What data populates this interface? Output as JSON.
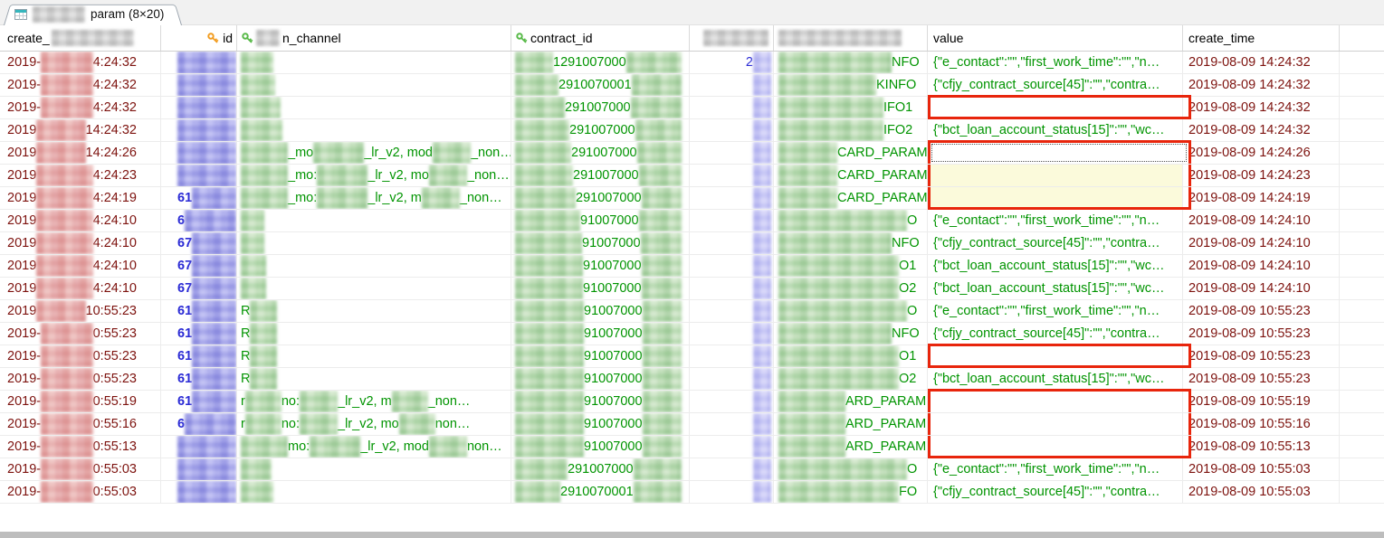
{
  "tab": {
    "label": "param (8×20)"
  },
  "header": {
    "c1": "create_",
    "c2": "id",
    "c3_suffix": "n_channel",
    "c4": "contract_id",
    "c7": "value",
    "c8": "create_time"
  },
  "colors": {
    "highlight_red": "#e8250c",
    "data_green": "#009400",
    "id_blue": "#2b2bd5",
    "datetime_maroon": "#7d120e",
    "selected_cell_yellow": "#fbfadb"
  },
  "rows": [
    {
      "tp": "2019-",
      "ts": "4:24:32",
      "id": "",
      "lead": "",
      "frags": [],
      "contract": "1291007000",
      "num": "2",
      "param": "NFO",
      "value": "{\"e_contact\":\"\",\"first_work_time\":\"\",\"n…",
      "ct": "2019-08-09 14:24:32",
      "vs": ""
    },
    {
      "tp": "2019-",
      "ts": "4:24:32",
      "id": "",
      "lead": "",
      "frags": [],
      "contract": "2910070001",
      "num": "",
      "param": "KINFO",
      "value": "{\"cfjy_contract_source[45]\":\"\",\"contra…",
      "ct": "2019-08-09 14:24:32",
      "vs": ""
    },
    {
      "tp": "2019-",
      "ts": "4:24:32",
      "id": "",
      "lead": "",
      "frags": [],
      "contract": "291007000",
      "num": "",
      "param": "IFO1",
      "value": "",
      "ct": "2019-08-09 14:24:32",
      "vs": "box"
    },
    {
      "tp": "2019",
      "ts": "14:24:32",
      "id": "",
      "lead": "",
      "frags": [],
      "contract": "291007000",
      "num": "",
      "param": "IFO2",
      "value": "{\"bct_loan_account_status[15]\":\"\",\"wc…",
      "ct": "2019-08-09 14:24:32",
      "vs": ""
    },
    {
      "tp": "2019",
      "ts": "14:24:26",
      "id": "",
      "lead": "",
      "frags": [
        "_mo",
        "_lr_v2, mod",
        "_non…"
      ],
      "contract": "291007000",
      "num": "",
      "param": "CARD_PARAM",
      "value": "",
      "ct": "2019-08-09 14:24:26",
      "vs": "boxtop focus"
    },
    {
      "tp": "2019",
      "ts": "4:24:23",
      "id": "",
      "lead": "",
      "frags": [
        "_mo:",
        "_lr_v2, mo",
        "_non…"
      ],
      "contract": "291007000",
      "num": "",
      "param": "CARD_PARAM",
      "value": "",
      "ct": "2019-08-09 14:24:23",
      "vs": "boxmid yellow"
    },
    {
      "tp": "2019",
      "ts": "4:24:19",
      "id": "61",
      "lead": "",
      "frags": [
        "_mo:",
        "_lr_v2, m",
        "_non…"
      ],
      "contract": "291007000",
      "num": "",
      "param": "CARD_PARAM",
      "value": "",
      "ct": "2019-08-09 14:24:19",
      "vs": "boxbot yellow"
    },
    {
      "tp": "2019",
      "ts": "4:24:10",
      "id": "6",
      "lead": "",
      "frags": [],
      "contract": "91007000",
      "num": "",
      "param": "O",
      "value": "{\"e_contact\":\"\",\"first_work_time\":\"\",\"n…",
      "ct": "2019-08-09 14:24:10",
      "vs": ""
    },
    {
      "tp": "2019",
      "ts": "4:24:10",
      "id": "67",
      "lead": "",
      "frags": [],
      "contract": "91007000",
      "num": "",
      "param": "NFO",
      "value": "{\"cfjy_contract_source[45]\":\"\",\"contra…",
      "ct": "2019-08-09 14:24:10",
      "vs": ""
    },
    {
      "tp": "2019",
      "ts": "4:24:10",
      "id": "67",
      "lead": "",
      "frags": [],
      "contract": "91007000",
      "num": "",
      "param": "O1",
      "value": "{\"bct_loan_account_status[15]\":\"\",\"wc…",
      "ct": "2019-08-09 14:24:10",
      "vs": ""
    },
    {
      "tp": "2019",
      "ts": "4:24:10",
      "id": "67",
      "lead": "",
      "frags": [],
      "contract": "91007000",
      "num": "",
      "param": "O2",
      "value": "{\"bct_loan_account_status[15]\":\"\",\"wc…",
      "ct": "2019-08-09 14:24:10",
      "vs": ""
    },
    {
      "tp": "2019",
      "ts": "10:55:23",
      "id": "61",
      "lead": "R",
      "frags": [],
      "contract": "91007000",
      "num": "",
      "param": "O",
      "value": "{\"e_contact\":\"\",\"first_work_time\":\"\",\"n…",
      "ct": "2019-08-09 10:55:23",
      "vs": ""
    },
    {
      "tp": "2019-",
      "ts": "0:55:23",
      "id": "61",
      "lead": "R",
      "frags": [],
      "contract": "91007000",
      "num": "",
      "param": "NFO",
      "value": "{\"cfjy_contract_source[45]\":\"\",\"contra…",
      "ct": "2019-08-09 10:55:23",
      "vs": ""
    },
    {
      "tp": "2019-",
      "ts": "0:55:23",
      "id": "61",
      "lead": "R",
      "frags": [],
      "contract": "91007000",
      "num": "",
      "param": "O1",
      "value": "",
      "ct": "2019-08-09 10:55:23",
      "vs": "box"
    },
    {
      "tp": "2019-",
      "ts": "0:55:23",
      "id": "61",
      "lead": "R",
      "frags": [],
      "contract": "91007000",
      "num": "",
      "param": "O2",
      "value": "{\"bct_loan_account_status[15]\":\"\",\"wc…",
      "ct": "2019-08-09 10:55:23",
      "vs": ""
    },
    {
      "tp": "2019-",
      "ts": "0:55:19",
      "id": "61",
      "lead": "r",
      "frags": [
        "no:",
        "_lr_v2, m",
        "_non…"
      ],
      "contract": "91007000",
      "num": "",
      "param": "ARD_PARAM",
      "value": "",
      "ct": "2019-08-09 10:55:19",
      "vs": "boxtop"
    },
    {
      "tp": "2019-",
      "ts": "0:55:16",
      "id": "6",
      "lead": "r",
      "frags": [
        "no:",
        "_lr_v2, mo",
        "non…"
      ],
      "contract": "91007000",
      "num": "",
      "param": "ARD_PARAM",
      "value": "",
      "ct": "2019-08-09 10:55:16",
      "vs": "boxmid"
    },
    {
      "tp": "2019-",
      "ts": "0:55:13",
      "id": "",
      "lead": "",
      "frags": [
        "mo:",
        "_lr_v2, mod",
        "non…"
      ],
      "contract": "91007000",
      "num": "",
      "param": "ARD_PARAM",
      "value": "",
      "ct": "2019-08-09 10:55:13",
      "vs": "boxbot"
    },
    {
      "tp": "2019-",
      "ts": "0:55:03",
      "id": "",
      "lead": "",
      "frags": [],
      "contract": "291007000",
      "num": "",
      "param": "O",
      "value": "{\"e_contact\":\"\",\"first_work_time\":\"\",\"n…",
      "ct": "2019-08-09 10:55:03",
      "vs": ""
    },
    {
      "tp": "2019-",
      "ts": "0:55:03",
      "id": "",
      "lead": "",
      "frags": [],
      "contract": "2910070001",
      "num": "",
      "param": "FO",
      "value": "{\"cfjy_contract_source[45]\":\"\",\"contra…",
      "ct": "2019-08-09 10:55:03",
      "vs": ""
    }
  ]
}
